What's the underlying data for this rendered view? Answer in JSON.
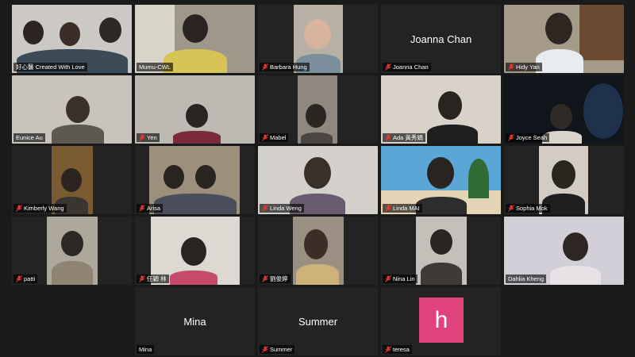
{
  "participants": [
    {
      "name": "好心醫 Created With Love",
      "muted": false
    },
    {
      "name": "Mumu-CWL",
      "muted": false
    },
    {
      "name": "Barbara Hung",
      "muted": true
    },
    {
      "name": "Joanna Chan",
      "muted": true,
      "display_name": "Joanna Chan"
    },
    {
      "name": "Hidy Yan",
      "muted": true
    },
    {
      "name": "Eunice Au",
      "muted": false
    },
    {
      "name": "Yen",
      "muted": true
    },
    {
      "name": "Mabel",
      "muted": true
    },
    {
      "name": "Ada 黃秀娟",
      "muted": true
    },
    {
      "name": "Joyce Seah",
      "muted": true
    },
    {
      "name": "Kimberly Wang",
      "muted": true
    },
    {
      "name": "Arisa",
      "muted": true
    },
    {
      "name": "Linda Weng",
      "muted": true
    },
    {
      "name": "Linda MAI",
      "muted": true
    },
    {
      "name": "Sophia Mok",
      "muted": true
    },
    {
      "name": "patti",
      "muted": true
    },
    {
      "name": "任穎 林",
      "muted": true
    },
    {
      "name": "劉俊婷",
      "muted": true
    },
    {
      "name": "Nina Lin",
      "muted": true
    },
    {
      "name": "Dahlia Kheng",
      "muted": false
    },
    {
      "name": "Mina",
      "muted": false,
      "display_name": "Mina"
    },
    {
      "name": "Summer",
      "muted": true,
      "display_name": "Summer"
    },
    {
      "name": "teresa",
      "muted": true,
      "avatar_letter": "h"
    }
  ],
  "colors": {
    "active_speaker": "#3dc53d",
    "muted_icon": "#e53935",
    "avatar": "#e0427c"
  }
}
